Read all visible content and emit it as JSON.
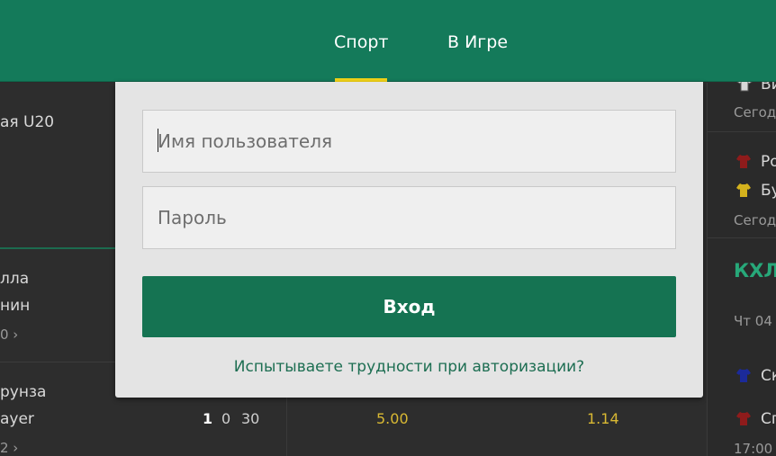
{
  "header": {
    "tabs": [
      {
        "label": "Спорт",
        "active": true
      },
      {
        "label": "В Игре",
        "active": false
      }
    ],
    "colors": {
      "bar": "#147a5a",
      "active_underline": "#f3d417"
    }
  },
  "background": {
    "left": {
      "league": "ая U20",
      "match1": {
        "team1": "лла",
        "team2": "нин",
        "more": "0 ›"
      },
      "match2": {
        "team1": "рунза",
        "team2": "ayer",
        "more": "2 ›",
        "score": [
          "1",
          "0",
          "30"
        ]
      }
    },
    "middle": {
      "odds": [
        "5.00",
        "1.14"
      ]
    },
    "right": {
      "item1": {
        "team": "Ви",
        "time": "Сегод"
      },
      "item2": {
        "team1": "Ро",
        "team2": "Бу",
        "time": "Сегод"
      },
      "section_title": "КХЛ",
      "date": "Чт 04",
      "item3": {
        "team1": "Ск",
        "team2": "Сп",
        "time": "17:00"
      }
    }
  },
  "login": {
    "username_placeholder": "Имя пользователя",
    "password_placeholder": "Пароль",
    "submit_label": "Вход",
    "help_link": "Испытываете трудности при авторизации?",
    "colors": {
      "button": "#157352",
      "link": "#1d6e52"
    }
  }
}
